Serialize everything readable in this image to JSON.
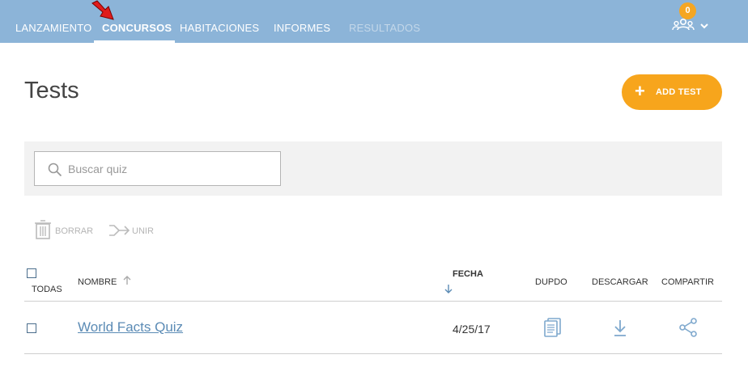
{
  "nav": {
    "items": [
      {
        "label": "LANZAMIENTO"
      },
      {
        "label": "CONCURSOS"
      },
      {
        "label": "HABITACIONES"
      },
      {
        "label": "INFORMES"
      },
      {
        "label": "RESULTADOS"
      }
    ],
    "badge_count": "0"
  },
  "header": {
    "title": "Tests",
    "add_button_label": "ADD TEST"
  },
  "search": {
    "placeholder": "Buscar quiz",
    "value": ""
  },
  "toolbar": {
    "delete_label": "BORRAR",
    "merge_label": "UNIR"
  },
  "table": {
    "columns": {
      "all": "TODAS",
      "name": "NOMBRE",
      "date": "FECHA",
      "duplicate": "DUPDO",
      "download": "DESCARGAR",
      "share": "COMPARTIR"
    },
    "rows": [
      {
        "name": "World Facts Quiz",
        "date": "4/25/17"
      }
    ]
  },
  "colors": {
    "nav_bg": "#8cb4d8",
    "accent": "#f7a51c",
    "link": "#5b8bb5",
    "icon_blue": "#7ea8cd"
  },
  "icons": [
    "people-icon",
    "chevron-down-icon",
    "plus-icon",
    "search-icon",
    "trash-icon",
    "merge-icon",
    "sort-arrow-icon",
    "copy-icon",
    "download-icon",
    "share-icon"
  ]
}
